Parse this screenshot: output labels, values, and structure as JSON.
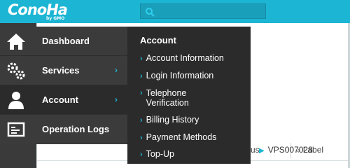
{
  "app": {
    "logo": "ConoHa",
    "logo_sub": "by GMO",
    "brand_color": "#1cb5d3"
  },
  "search": {
    "placeholder": ""
  },
  "nav": {
    "items": [
      {
        "label": "Dashboard",
        "icon": "home-icon",
        "has_arrow": false
      },
      {
        "label": "Services",
        "icon": "gears-icon",
        "has_arrow": true,
        "arrow": "›"
      },
      {
        "label": "Account",
        "icon": "user-icon",
        "has_arrow": true,
        "arrow": "›",
        "active": true
      },
      {
        "label": "Operation Logs",
        "icon": "log-icon",
        "has_arrow": false
      }
    ]
  },
  "submenu": {
    "title": "Account",
    "items": [
      {
        "label": "Account Information"
      },
      {
        "label": "Login Information"
      },
      {
        "label": "Telephone Verification"
      },
      {
        "label": "Billing History"
      },
      {
        "label": "Payment Methods"
      },
      {
        "label": "Top-Up"
      }
    ]
  },
  "table": {
    "col_status_fragment": "us",
    "col_label": "Label",
    "sort_glyph": "≑",
    "row_value": "VPS007028"
  }
}
